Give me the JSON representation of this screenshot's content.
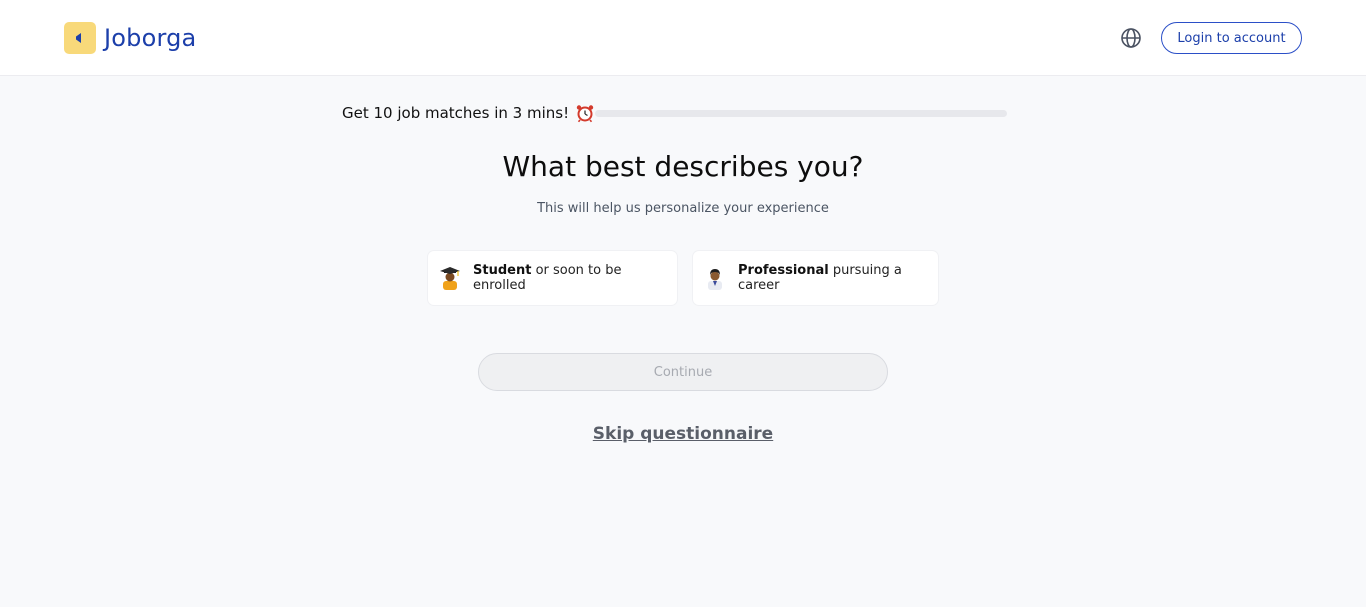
{
  "header": {
    "brand": "Joborga",
    "login_label": "Login to account",
    "language_icon": "globe-icon",
    "colors": {
      "brand": "#1c3faa",
      "logo_bg": "#f8d97a"
    }
  },
  "progress": {
    "label": "Get 10 job matches in 3 mins!",
    "icon": "alarm-clock-icon",
    "value_fraction": 0
  },
  "question": {
    "title": "What best describes you?",
    "subtitle": "This will help us personalize your experience"
  },
  "options": [
    {
      "strong": "Student",
      "rest": " or soon to be enrolled",
      "icon": "student-avatar-icon"
    },
    {
      "strong": "Professional",
      "rest": " pursuing a career",
      "icon": "professional-avatar-icon"
    }
  ],
  "actions": {
    "continue_label": "Continue",
    "continue_disabled": true,
    "skip_label": "Skip questionnaire"
  }
}
